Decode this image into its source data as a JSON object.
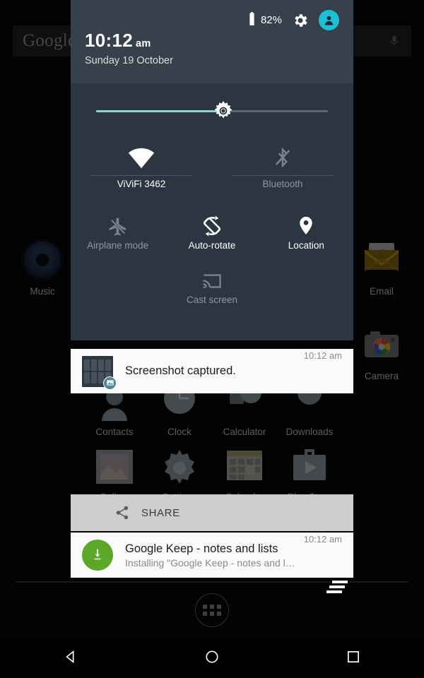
{
  "home": {
    "search": {
      "logo_text": "Google",
      "mic_icon": "microphone-icon"
    },
    "apps": [
      {
        "label": "Music",
        "icon": "music-icon"
      },
      {
        "label": "Email",
        "icon": "email-icon"
      },
      {
        "label": "Camera",
        "icon": "camera-icon"
      }
    ],
    "drawer_apps": [
      {
        "label": "Contacts",
        "icon": "contacts-icon"
      },
      {
        "label": "Clock",
        "icon": "clock-icon"
      },
      {
        "label": "Calculator",
        "icon": "calculator-icon"
      },
      {
        "label": "Downloads",
        "icon": "downloads-icon"
      },
      {
        "label": "Gallery",
        "icon": "gallery-icon"
      },
      {
        "label": "Settings",
        "icon": "settings-gear-icon"
      },
      {
        "label": "Calendar",
        "icon": "calendar-icon"
      },
      {
        "label": "Play Store",
        "icon": "play-store-icon"
      }
    ],
    "all_apps_button": "all-apps-icon"
  },
  "quick_settings": {
    "battery_percent": "82%",
    "battery_icon": "battery-icon",
    "settings_icon": "gear-icon",
    "avatar_icon": "user-avatar-icon",
    "time": "10:12",
    "ampm": "am",
    "date": "Sunday 19 October",
    "brightness": {
      "icon": "brightness-sun-icon",
      "value": 55
    },
    "tiles": [
      {
        "label": "ViViFi 3462",
        "icon": "wifi-icon",
        "state": "on"
      },
      {
        "label": "Bluetooth",
        "icon": "bluetooth-off-icon",
        "state": "off"
      },
      {
        "label": "Airplane mode",
        "icon": "airplane-off-icon",
        "state": "off"
      },
      {
        "label": "Auto-rotate",
        "icon": "auto-rotate-icon",
        "state": "on"
      },
      {
        "label": "Location",
        "icon": "location-pin-icon",
        "state": "on"
      },
      {
        "label": "Cast screen",
        "icon": "cast-screen-icon",
        "state": "off"
      }
    ]
  },
  "notifications": [
    {
      "title": "Screenshot captured.",
      "time": "10:12 am",
      "icon": "screenshot-thumbnail",
      "badge_icon": "image-badge-icon",
      "action": {
        "label": "SHARE",
        "icon": "share-icon"
      }
    },
    {
      "title": "Google Keep - notes and lists",
      "subtitle": "Installing \"Google Keep - notes and lists\"…",
      "time": "10:12 am",
      "icon": "download-circle-icon"
    }
  ],
  "clear_all": {
    "icon": "clear-all-notifications-icon"
  },
  "navbar": {
    "back": "back-triangle-icon",
    "home": "home-circle-icon",
    "recents": "recents-square-icon"
  },
  "colors": {
    "panel_bg": "#2b3640",
    "panel_header_bg": "#36414b",
    "accent_teal": "#8fd4cc",
    "avatar_cyan": "#1ebed6",
    "keep_green": "#5ba828",
    "notif_bg": "#fafafa",
    "action_bg": "#cdcdcd"
  }
}
